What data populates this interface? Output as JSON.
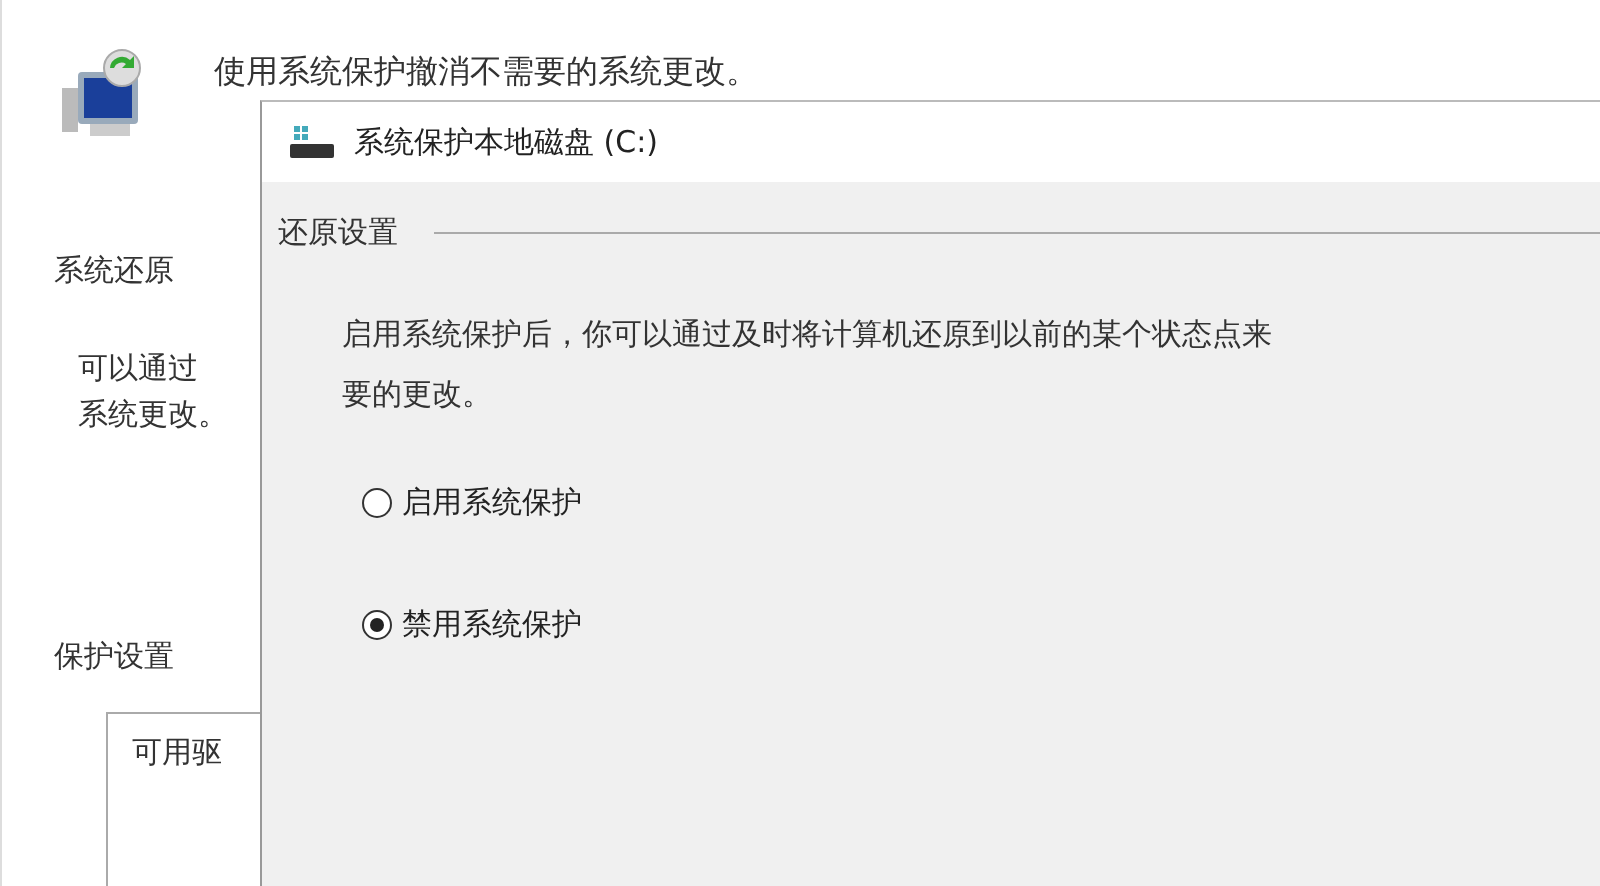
{
  "background_window": {
    "header": "使用系统保护撤消不需要的系统更改。",
    "system_restore": {
      "heading": "系统还原",
      "lines": [
        "可以通过",
        "系统更改。"
      ]
    },
    "protection_settings": {
      "heading": "保护设置",
      "column_1": "可用驱"
    }
  },
  "dialog": {
    "title": "系统保护本地磁盘 (C:)",
    "group": {
      "heading": "还原设置",
      "description_lines": [
        "启用系统保护后，你可以通过及时将计算机还原到以前的某个状态点来",
        "要的更改。"
      ],
      "options": [
        {
          "label": "启用系统保护",
          "selected": false
        },
        {
          "label": "禁用系统保护",
          "selected": true
        }
      ]
    }
  }
}
